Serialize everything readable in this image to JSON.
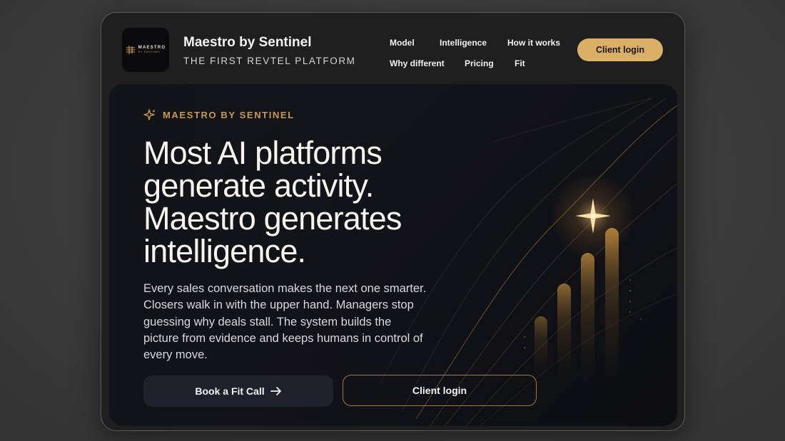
{
  "brand": {
    "logo_wordmark": "MAESTRO",
    "logo_byline": "BY SENTINEL",
    "title": "Maestro by Sentinel",
    "subtitle": "THE FIRST REVTEL PLATFORM"
  },
  "nav": {
    "items": [
      "Model",
      "Intelligence",
      "How it works",
      "Why different",
      "Pricing",
      "Fit"
    ],
    "client_login": "Client login"
  },
  "hero": {
    "eyebrow": "MAESTRO BY SENTINEL",
    "headline": "Most AI platforms generate activity. Maestro generates intelligence.",
    "body": "Every sales conversation makes the next one smarter. Closers walk in with the upper hand. Managers stop guessing why deals stall. The system builds the picture from evidence and keeps humans in control of every move.",
    "primary_cta": "Book a Fit Call",
    "secondary_cta": "Client login"
  },
  "colors": {
    "accent_gold": "#d9b065",
    "eyebrow_gold": "#c99a4e",
    "hero_bg": "#121318",
    "frame_bg": "#1f1f20"
  },
  "icons": {
    "eyebrow": "sparkle-icon",
    "primary_cta": "arrow-right-icon",
    "decoration": "four-point-star-icon"
  }
}
